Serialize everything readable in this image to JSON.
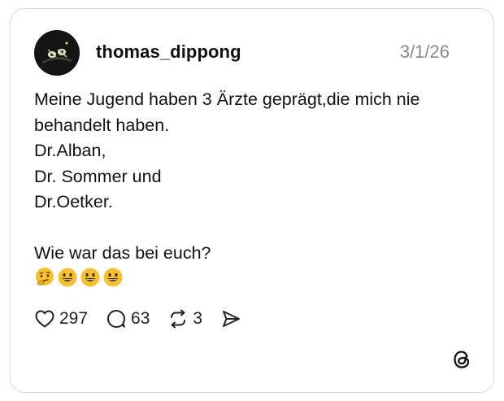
{
  "post": {
    "username": "thomas_dippong",
    "date": "3/1/26",
    "lines": [
      "Meine Jugend haben 3 Ärzte geprägt,die mich nie",
      "behandelt haben.",
      "Dr.Alban,",
      "Dr. Sommer und",
      "Dr.Oetker.",
      "",
      "Wie war das bei euch?"
    ],
    "emojis": [
      "thinking-face",
      "grinning-face",
      "grinning-face",
      "grinning-face"
    ]
  },
  "actions": {
    "likes": "297",
    "replies": "63",
    "reposts": "3"
  },
  "icons": {
    "like": "heart-icon",
    "reply": "speech-bubble-icon",
    "repost": "repost-icon",
    "share": "send-icon",
    "brand": "threads-logo-icon"
  },
  "colors": {
    "text": "#111111",
    "muted": "#8a8a8a",
    "border": "#d9d9d9",
    "emoji_yellow": "#f6c030"
  }
}
